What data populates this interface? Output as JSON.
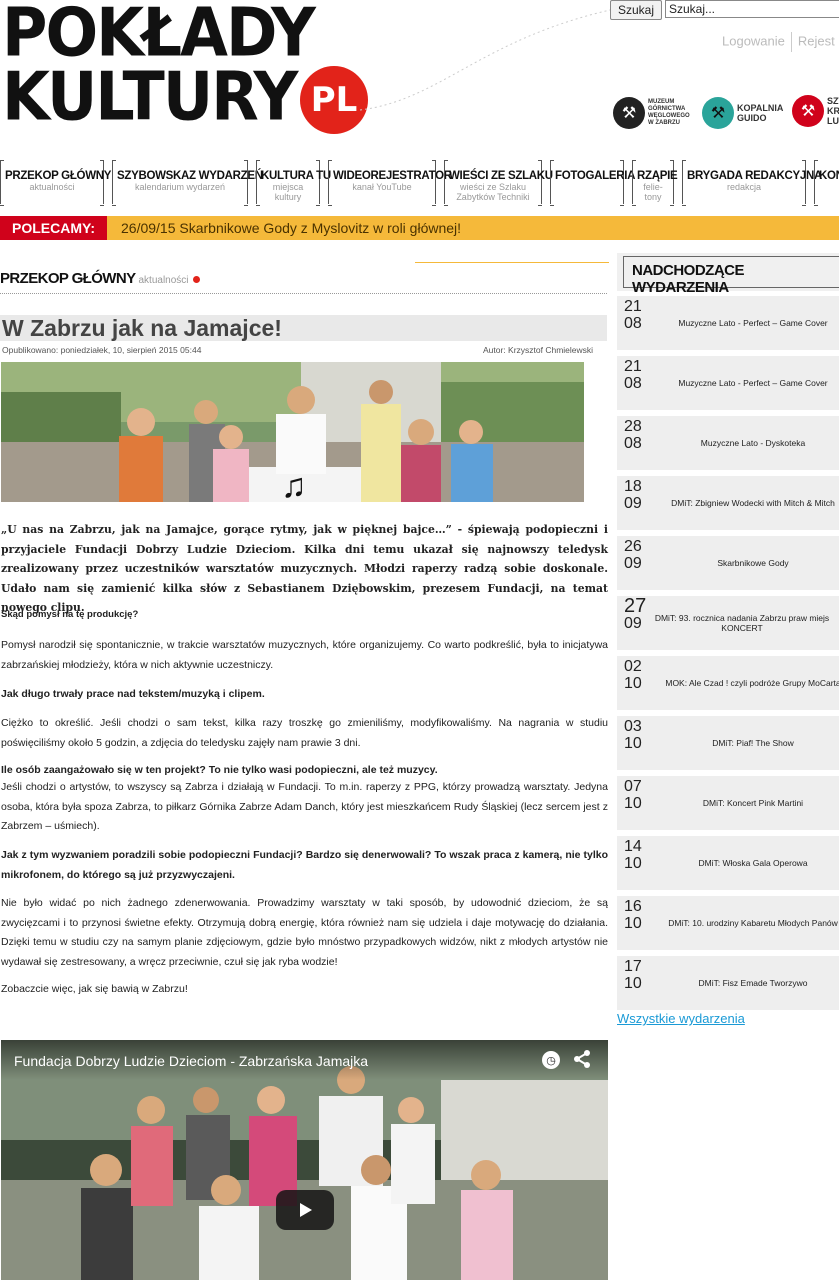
{
  "header": {
    "logo_line1": "POKŁADY",
    "logo_line2": "KULTURY",
    "logo_badge": "PL",
    "search_button": "Szukaj",
    "search_value": "Szukaj...",
    "login_link": "Logowanie",
    "register_link": "Rejest",
    "sponsors": [
      {
        "name": "MUZEUM GÓRNICTWA WĘGLOWEGO W ZABRZU"
      },
      {
        "name": "KOPALNIA GUIDO"
      },
      {
        "name": "SZT KR LUD"
      }
    ]
  },
  "nav": [
    {
      "label": "PRZEKOP GŁÓWNY",
      "sub": "aktualności"
    },
    {
      "label": "SZYBOWSKAZ WYDARZEŃ",
      "sub": "kalendarium wydarzeń"
    },
    {
      "label": "KULTURA TU",
      "sub": "miejsca kultury"
    },
    {
      "label": "WIDEOREJESTRATOR",
      "sub": "kanał YouTube"
    },
    {
      "label": "WIEŚCI ZE SZLAKU",
      "sub": "wieści ze Szlaku Zabytków Techniki"
    },
    {
      "label": "FOTOGALERIA",
      "sub": ""
    },
    {
      "label": "RZĄPIE",
      "sub": "felie-tony"
    },
    {
      "label": "BRYGADA REDAKCYJNA",
      "sub": "redakcja"
    },
    {
      "label": "KON",
      "sub": ""
    }
  ],
  "recommended": {
    "label": "POLECAMY:",
    "text": "26/09/15 Skarbnikowe Gody z Myslovitz w roli głównej!"
  },
  "section": {
    "title": "PRZEKOP GŁÓWNY",
    "subtitle": "aktualności"
  },
  "article": {
    "title": "W Zabrzu jak na Jamajce!",
    "published": "Opublikowano: poniedziałek, 10, sierpień 2015 05:44",
    "author": "Autor: Krzysztof Chmielewski",
    "lead": "„U nas na Zabrzu, jak na Jamajce, gorące rytmy, jak w pięknej bajce…” - śpiewają podopieczni i przyjaciele Fundacji Dobrzy Ludzie Dzieciom. Kilka dni temu ukazał się najnowszy teledysk zrealizowany przez uczestników warsztatów muzycznych. Młodzi raperzy radzą sobie doskonale. Udało nam się zamienić kilka słów z Sebastianem Dziębowskim, prezesem Fundacji, na temat nowego clipu.",
    "q1": "Skąd pomysł na tę produkcję?",
    "a1": "Pomysł narodził się spontanicznie, w trakcie warsztatów muzycznych, które organizujemy. Co warto podkreślić, była to inicjatywa zabrzańskiej młodzieży, która w nich aktywnie uczestniczy.",
    "q2": "Jak długo trwały prace nad tekstem/muzyką i clipem.",
    "a2": "Ciężko to określić. Jeśli chodzi o sam tekst, kilka razy troszkę go zmieniliśmy, modyfikowaliśmy. Na nagrania w studiu poświęciliśmy około 5 godzin, a zdjęcia do teledysku zajęły nam prawie 3 dni.",
    "q3": "Ile osób zaangażowało się w ten projekt? To nie tylko wasi podopieczni, ale też muzycy.",
    "a3": "Jeśli chodzi o artystów, to wszyscy są Zabrza i działają w Fundacji. To m.in. raperzy z PPG, którzy prowadzą warsztaty. Jedyna osoba, która była spoza Zabrza, to piłkarz Górnika Zabrze Adam Danch, który jest mieszkańcem Rudy Śląskiej (lecz sercem jest z Zabrzem – uśmiech).",
    "q4": "Jak z tym wyzwaniem poradzili sobie podopieczni Fundacji? Bardzo się denerwowali? To wszak praca z kamerą, nie tylko mikrofonem, do którego są już przyzwyczajeni.",
    "a4": "Nie było widać po nich żadnego zdenerwowania. Prowadzimy warsztaty w taki sposób, by udowodnić dzieciom, że są zwycięzcami i to przynosi świetne efekty. Otrzymują dobrą energię, która również nam się udziela i daje motywację do działania. Dzięki temu w studiu czy na samym planie zdjęciowym, gdzie było mnóstwo przypadkowych widzów, nikt z młodych artystów  nie wydawał się zestresowany, a wręcz przeciwnie, czuł się jak ryba wodzie!",
    "closing": "Zobaczcie więc, jak się bawią w Zabrzu!",
    "video_title": "Fundacja Dobrzy Ludzie Dzieciom - Zabrzańska Jamajka"
  },
  "sidebar": {
    "title": "NADCHODZĄCE WYDARZENIA",
    "events": [
      {
        "day": "21",
        "month": "08",
        "name": "Muzyczne Lato - Perfect – Game Cover"
      },
      {
        "day": "21",
        "month": "08",
        "name": "Muzyczne Lato - Perfect – Game Cover"
      },
      {
        "day": "28",
        "month": "08",
        "name": "Muzyczne Lato - Dyskoteka"
      },
      {
        "day": "18",
        "month": "09",
        "name": "DMiT: Zbigniew Wodecki with Mitch & Mitch"
      },
      {
        "day": "26",
        "month": "09",
        "name": "Skarbnikowe Gody"
      },
      {
        "day": "27",
        "month": "09",
        "name": "DMiT: 93. rocznica nadania Zabrzu praw miejs KONCERT"
      },
      {
        "day": "02",
        "month": "10",
        "name": "MOK: Ale Czad ! czyli podróże Grupy MoCarta"
      },
      {
        "day": "03",
        "month": "10",
        "name": "DMiT: Piaf! The Show"
      },
      {
        "day": "07",
        "month": "10",
        "name": "DMiT: Koncert Pink Martini"
      },
      {
        "day": "14",
        "month": "10",
        "name": "DMiT: Włoska Gala Operowa"
      },
      {
        "day": "16",
        "month": "10",
        "name": "DMiT: 10. urodziny Kabaretu Młodych Panów"
      },
      {
        "day": "17",
        "month": "10",
        "name": "DMiT: Fisz Emade Tworzywo"
      }
    ],
    "all_events": "Wszystkie wydarzenia"
  },
  "colors": {
    "accent_red": "#d0021b",
    "accent_orange": "#f5b93a",
    "link_blue": "#1a9ad6"
  }
}
